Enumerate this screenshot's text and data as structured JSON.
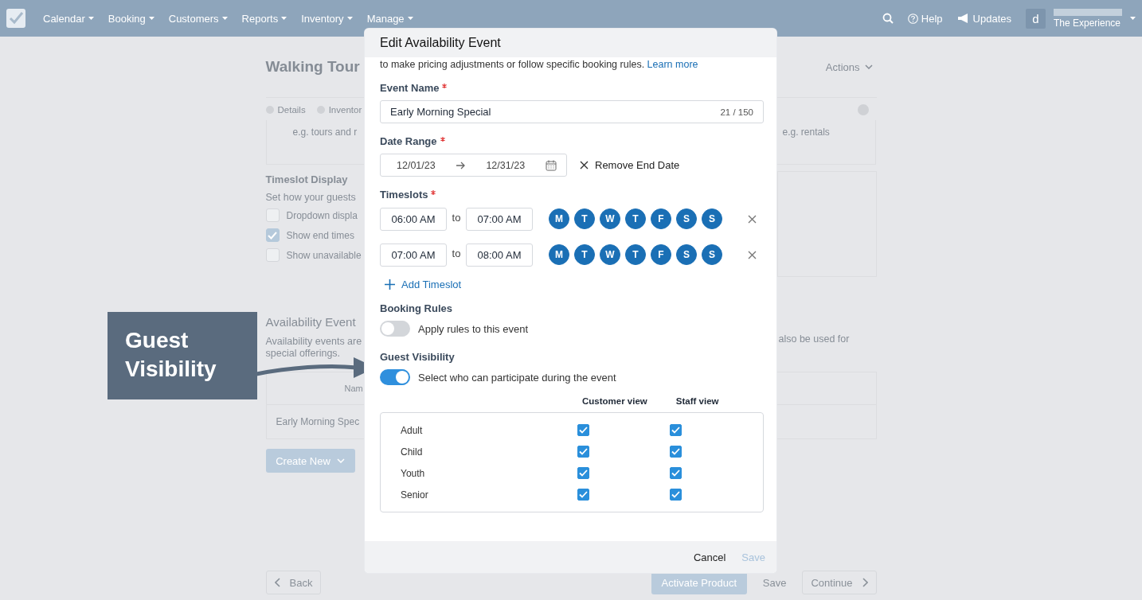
{
  "nav": {
    "items": [
      "Calendar",
      "Booking",
      "Customers",
      "Reports",
      "Inventory",
      "Manage"
    ],
    "help": "Help",
    "updates": "Updates",
    "avatar_letter": "d",
    "account": "The Experience"
  },
  "page": {
    "title": "Walking Tour",
    "actions": "Actions",
    "tabs": [
      "Details",
      "Inventor"
    ],
    "type_cards": [
      "e.g. tours and r",
      "e.g. rentals"
    ],
    "timeslot_display": {
      "title": "Timeslot Display",
      "description": "Set how your guests",
      "options": [
        {
          "label": "Dropdown displa",
          "checked": false
        },
        {
          "label": "Show end times",
          "checked": true
        },
        {
          "label": "Show unavailable",
          "checked": false
        }
      ]
    },
    "availability_events": {
      "title": "Availability Event",
      "description_lines": [
        "Availability events are",
        "special offerings."
      ],
      "description_right": "also be used for",
      "columns": [
        "Nam"
      ],
      "rows": [
        [
          "Early Morning Spec"
        ]
      ],
      "create_button": "Create New"
    }
  },
  "footer": {
    "back": "Back",
    "activate": "Activate Product",
    "save": "Save",
    "continue": "Continue"
  },
  "modal": {
    "title": "Edit Availability Event",
    "intro": "to make pricing adjustments or follow specific booking rules.",
    "learn_more": "Learn more",
    "event_name": {
      "label": "Event Name",
      "required": true,
      "value": "Early Morning Special",
      "counter": "21 / 150"
    },
    "date_range": {
      "label": "Date Range",
      "required": true,
      "start": "12/01/23",
      "end": "12/31/23",
      "remove_end": "Remove End Date"
    },
    "timeslots": {
      "label": "Timeslots",
      "required": true,
      "add": "Add Timeslot",
      "rows": [
        {
          "start": "06:00 AM",
          "to": "to",
          "end": "07:00 AM",
          "days": [
            {
              "label": "M",
              "selected": true
            },
            {
              "label": "T",
              "selected": true
            },
            {
              "label": "W",
              "selected": true
            },
            {
              "label": "T",
              "selected": true
            },
            {
              "label": "F",
              "selected": true
            },
            {
              "label": "S",
              "selected": true
            },
            {
              "label": "S",
              "selected": true
            }
          ]
        },
        {
          "start": "07:00 AM",
          "to": "to",
          "end": "08:00 AM",
          "days": [
            {
              "label": "M",
              "selected": true
            },
            {
              "label": "T",
              "selected": true
            },
            {
              "label": "W",
              "selected": true
            },
            {
              "label": "T",
              "selected": true
            },
            {
              "label": "F",
              "selected": true
            },
            {
              "label": "S",
              "selected": true
            },
            {
              "label": "S",
              "selected": true
            }
          ]
        }
      ]
    },
    "booking_rules": {
      "label": "Booking Rules",
      "on": false,
      "text": "Apply rules to this event"
    },
    "guest_visibility": {
      "label": "Guest Visibility",
      "on": true,
      "text": "Select who can participate during the event",
      "columns": [
        "Customer view",
        "Staff view"
      ],
      "rows": [
        {
          "name": "Adult",
          "customer": true,
          "staff": true
        },
        {
          "name": "Child",
          "customer": true,
          "staff": true
        },
        {
          "name": "Youth",
          "customer": true,
          "staff": true
        },
        {
          "name": "Senior",
          "customer": true,
          "staff": true
        }
      ]
    },
    "cancel": "Cancel",
    "save": "Save",
    "save_disabled": true
  },
  "callout": {
    "text": "Guest Visibility"
  }
}
